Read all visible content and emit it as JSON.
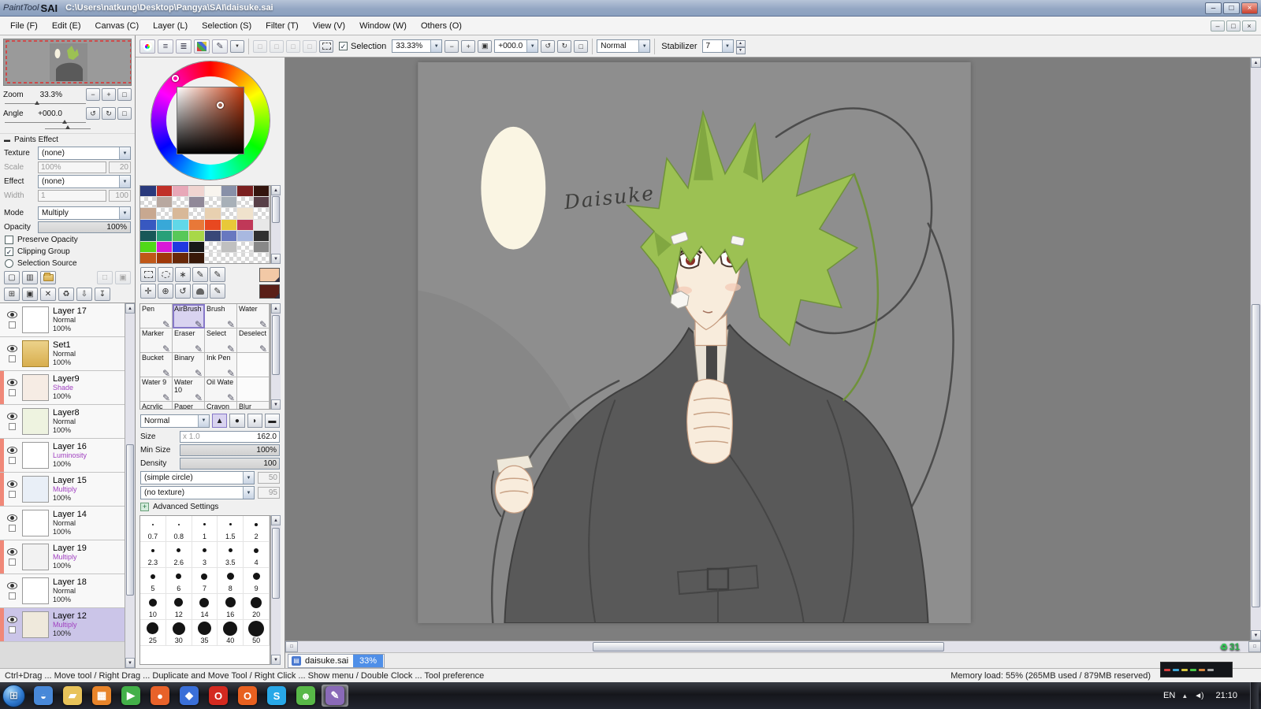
{
  "titlebar": {
    "brand_a": "PaintTool",
    "brand_b": "SAI",
    "path": "C:\\Users\\natkung\\Desktop\\Pangya\\SAI\\daisuke.sai"
  },
  "menubar": {
    "items": [
      "File (F)",
      "Edit (E)",
      "Canvas (C)",
      "Layer (L)",
      "Selection (S)",
      "Filter (T)",
      "View (V)",
      "Window (W)",
      "Others (O)"
    ]
  },
  "toolbar": {
    "selection_label": "Selection",
    "zoom_value": "33.33%",
    "angle_value": "+000.0",
    "paint_mode": "Normal",
    "stabilizer_label": "Stabilizer",
    "stabilizer_value": "7"
  },
  "navigator": {
    "zoom_label": "Zoom",
    "zoom_value": "33.3%",
    "angle_label": "Angle",
    "angle_value": "+000.0"
  },
  "paints_effect": {
    "title": "Paints Effect",
    "texture_label": "Texture",
    "texture_value": "(none)",
    "scale_label": "Scale",
    "scale_pct": "100%",
    "scale_value": "20",
    "effect_label": "Effect",
    "effect_value": "(none)",
    "width_label": "Width",
    "width_pct": "1",
    "width_value": "100"
  },
  "layer_panel": {
    "mode_label": "Mode",
    "mode_value": "Multiply",
    "opacity_label": "Opacity",
    "opacity_value": "100%",
    "preserve_opacity_label": "Preserve Opacity",
    "clipping_group_label": "Clipping Group",
    "selection_source_label": "Selection Source",
    "layers": [
      {
        "name": "Layer 17",
        "mode": "Normal",
        "opacity": "100%",
        "thumb": "#ffffff"
      },
      {
        "name": "Set1",
        "mode": "Normal",
        "opacity": "100%",
        "folder": true
      },
      {
        "name": "Layer9",
        "mode": "Shade",
        "opacity": "100%",
        "clipped": true,
        "tinted": true,
        "thumb": "#f6ece4"
      },
      {
        "name": "Layer8",
        "mode": "Normal",
        "opacity": "100%",
        "thumb": "#eef3e0"
      },
      {
        "name": "Layer 16",
        "mode": "Luminosity",
        "opacity": "100%",
        "clipped": true,
        "tinted": true,
        "thumb": "#ffffff"
      },
      {
        "name": "Layer 15",
        "mode": "Multiply",
        "opacity": "100%",
        "clipped": true,
        "tinted": true,
        "thumb": "#e9eff7"
      },
      {
        "name": "Layer 14",
        "mode": "Normal",
        "opacity": "100%",
        "thumb": "#ffffff"
      },
      {
        "name": "Layer 19",
        "mode": "Multiply",
        "opacity": "100%",
        "clipped": true,
        "tinted": true,
        "thumb": "#f2f2f2"
      },
      {
        "name": "Layer 18",
        "mode": "Normal",
        "opacity": "100%",
        "thumb": "#ffffff"
      },
      {
        "name": "Layer 12",
        "mode": "Multiply",
        "opacity": "100%",
        "clipped": true,
        "tinted": true,
        "selected": true,
        "thumb": "#efe9dc"
      }
    ]
  },
  "tool_panel": {
    "tools": [
      {
        "label": "Pen"
      },
      {
        "label": "AirBrush",
        "selected": true
      },
      {
        "label": "Brush"
      },
      {
        "label": "Water"
      },
      {
        "label": "Marker"
      },
      {
        "label": "Eraser"
      },
      {
        "label": "Select"
      },
      {
        "label": "Deselect"
      },
      {
        "label": "Bucket"
      },
      {
        "label": "Binary"
      },
      {
        "label": "Ink Pen"
      },
      {
        "label": "",
        "empty": true
      },
      {
        "label": "Water 9"
      },
      {
        "label": "Water 10"
      },
      {
        "label": "Oil Wate"
      },
      {
        "label": "",
        "empty": true
      },
      {
        "label": "Acrylic"
      },
      {
        "label": "Paper"
      },
      {
        "label": "Crayon"
      },
      {
        "label": "Blur"
      }
    ],
    "brush_mode": "Normal",
    "size_label": "Size",
    "size_mult": "x 1.0",
    "size_value": "162.0",
    "min_size_label": "Min Size",
    "min_size_value": "100%",
    "density_label": "Density",
    "density_value": "100",
    "shape_value": "(simple circle)",
    "shape_num": "50",
    "texture_value": "(no texture)",
    "texture_num": "95",
    "advanced_label": "Advanced Settings",
    "presets": [
      {
        "v": "0.7",
        "d": 2
      },
      {
        "v": "0.8",
        "d": 2
      },
      {
        "v": "1",
        "d": 3
      },
      {
        "v": "1.5",
        "d": 3
      },
      {
        "v": "2",
        "d": 4
      },
      {
        "v": "2.3",
        "d": 4
      },
      {
        "v": "2.6",
        "d": 5
      },
      {
        "v": "3",
        "d": 5
      },
      {
        "v": "3.5",
        "d": 5
      },
      {
        "v": "4",
        "d": 6
      },
      {
        "v": "5",
        "d": 6
      },
      {
        "v": "6",
        "d": 7
      },
      {
        "v": "7",
        "d": 8
      },
      {
        "v": "8",
        "d": 9
      },
      {
        "v": "9",
        "d": 9
      },
      {
        "v": "10",
        "d": 10
      },
      {
        "v": "12",
        "d": 11
      },
      {
        "v": "14",
        "d": 12
      },
      {
        "v": "16",
        "d": 13
      },
      {
        "v": "20",
        "d": 14
      },
      {
        "v": "25",
        "d": 15
      },
      {
        "v": "30",
        "d": 16
      },
      {
        "v": "35",
        "d": 17
      },
      {
        "v": "40",
        "d": 18
      },
      {
        "v": "50",
        "d": 20
      }
    ]
  },
  "picker": {
    "hue": "#c03a10"
  },
  "current_colors": {
    "primary": "#f2c9a6",
    "secondary": "#5a1f18"
  },
  "palette": [
    "#2a3a7c",
    "#c03028",
    "#e8a8b8",
    "#f0d4d0",
    "#f8f4ee",
    "#8890a8",
    "#7a2020",
    "#33150e",
    "",
    "#b8a8a0",
    "",
    "#908898",
    "",
    "#a8b0b8",
    "",
    "#584048",
    "#c8a890",
    "",
    "#d8b898",
    "",
    "#e8d0b0",
    "",
    "#f0e2cc",
    "",
    "#3858c0",
    "#38a8d8",
    "#60d8e8",
    "#e87838",
    "#e84820",
    "#e8c838",
    "#c03858",
    "#e8e8e8",
    "#185858",
    "#28a078",
    "#58c858",
    "#a8d848",
    "#384878",
    "#6878c0",
    "#a8b8e0",
    "#303030",
    "#50d818",
    "#d818d8",
    "#2038e0",
    "#181818",
    "",
    "#c0c0c0",
    "",
    "#888888",
    "#c05818",
    "#a03808",
    "#682808",
    "#381808",
    "",
    "",
    "",
    ""
  ],
  "art": {
    "annotation": "Daisuke",
    "canvas_color": "#8e8e8e",
    "hair": "#9cc153",
    "skin": "#f8ecdc",
    "coat": "#595959",
    "oval": "#faf5e3",
    "eye": "#8a3226"
  },
  "doc_tab": {
    "name": "daisuke.sai",
    "zoom": "33%"
  },
  "statusbar": {
    "hint": "Ctrl+Drag ... Move tool / Right Drag ... Duplicate and Move Tool / Right Click ... Show menu / Double Clock ... Tool preference",
    "memory": "Memory load: 55% (265MB used / 879MB reserved)"
  },
  "taskbar": {
    "lang": "EN",
    "time": "21:10",
    "apps": [
      {
        "glyph": "◒",
        "color": "#4888d8"
      },
      {
        "glyph": "▰",
        "color": "#e8c35a"
      },
      {
        "glyph": "▦",
        "color": "#e8842a"
      },
      {
        "glyph": "▶",
        "color": "#43b049"
      },
      {
        "glyph": "●",
        "color": "#e8622a"
      },
      {
        "glyph": "◆",
        "color": "#3a6fd8"
      },
      {
        "glyph": "O",
        "color": "#d42a20"
      },
      {
        "glyph": "O",
        "color": "#e86020"
      },
      {
        "glyph": "S",
        "color": "#28a8e8"
      },
      {
        "glyph": "☻",
        "color": "#58b848"
      },
      {
        "glyph": "✎",
        "color": "#8a6ab8",
        "active": true
      }
    ]
  },
  "artifacts": {
    "counter": "31"
  },
  "icons": {
    "arrow_down": "▼",
    "arrow_up": "▲",
    "minus": "−",
    "plus": "+",
    "box": "□",
    "box_filled": "▣",
    "ccw": "↺",
    "cw": "↻",
    "check": "✓",
    "min": "–",
    "max": "□",
    "close": "×",
    "pen": "✎",
    "wand": "∗",
    "move": "✛",
    "zoom": "⊕",
    "lines": "≡",
    "lines2": "≣",
    "page": "▢",
    "pages": "▥",
    "grid_plus": "⊞",
    "copy": "▣",
    "clear": "✕",
    "trash": "♻",
    "down": "⇩",
    "merge": "↧",
    "collapse": "▬",
    "tri": "▲",
    "dot": "●",
    "half": "◗",
    "bar": "▬",
    "orb": "⊞",
    "vol": "◄)",
    "doc": "▤"
  }
}
